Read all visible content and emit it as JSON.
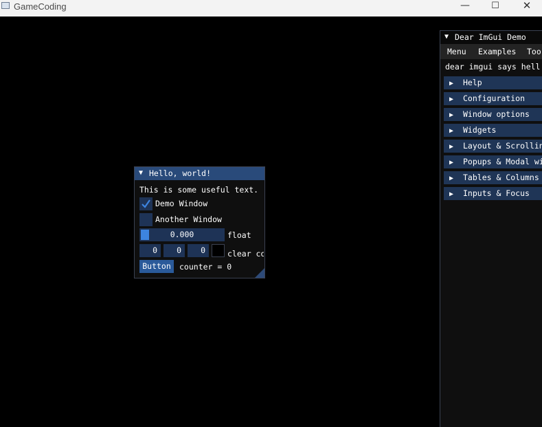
{
  "os_window": {
    "title": "GameCoding",
    "controls": {
      "minimize": "—",
      "maximize": "☐",
      "close": "✕"
    }
  },
  "hello_window": {
    "title": "Hello, world!",
    "collapse_glyph": "▼",
    "text": "This is some useful text.",
    "checkboxes": [
      {
        "label": "Demo Window",
        "checked": true
      },
      {
        "label": "Another Window",
        "checked": false
      }
    ],
    "slider": {
      "value": "0.000",
      "label": "float"
    },
    "color_edit": {
      "values": [
        "0",
        "0",
        "0"
      ],
      "label": "clear co"
    },
    "button_label": "Button",
    "counter_text": "counter = 0"
  },
  "demo_window": {
    "title": "Dear ImGui Demo",
    "collapse_glyph": "▼",
    "menu": [
      "Menu",
      "Examples",
      "Too"
    ],
    "intro_text": "dear imgui says hell",
    "headers": [
      "Help",
      "Configuration",
      "Window options",
      "Widgets",
      "Layout & Scrollin",
      "Popups & Modal wi",
      "Tables & Columns",
      "Inputs & Focus"
    ]
  },
  "colors": {
    "background": "#000000",
    "title_active": "#294a7a",
    "frame_bg": "#1e3356",
    "accent": "#3d84e0",
    "header_bg": "#1f3556"
  }
}
